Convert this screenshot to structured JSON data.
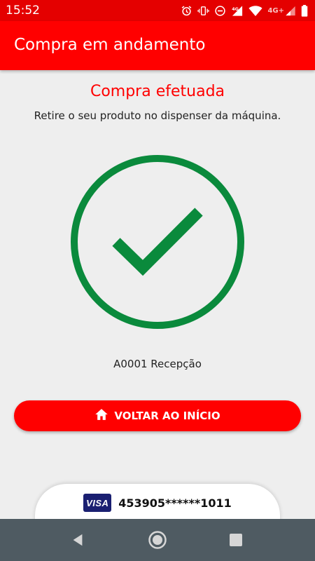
{
  "colors": {
    "status_bar": "#e40000",
    "app_bar": "#ff0000",
    "accent": "#ff0000",
    "success": "#0a8a3c",
    "background": "#eeeeee",
    "nav_bar": "#4f5b62"
  },
  "status_bar": {
    "time": "15:52",
    "network_label": "4G+",
    "icons": [
      "alarm-icon",
      "vibrate-icon",
      "do-not-disturb-icon",
      "signal-4g-icon",
      "wifi-icon",
      "signal-icon",
      "battery-icon"
    ]
  },
  "app_bar": {
    "title": "Compra em andamento"
  },
  "main": {
    "heading": "Compra efetuada",
    "subtitle": "Retire o seu produto no dispenser da máquina.",
    "success_icon": "check-circle-icon",
    "machine_label": "A0001 Recepção",
    "home_button": {
      "icon": "home-icon",
      "label": "VOLTAR AO INÍCIO"
    }
  },
  "payment_card": {
    "brand": "VISA",
    "number": "453905******1011"
  },
  "navigation": {
    "icons": [
      "back-icon",
      "home-nav-icon",
      "recents-icon"
    ]
  }
}
